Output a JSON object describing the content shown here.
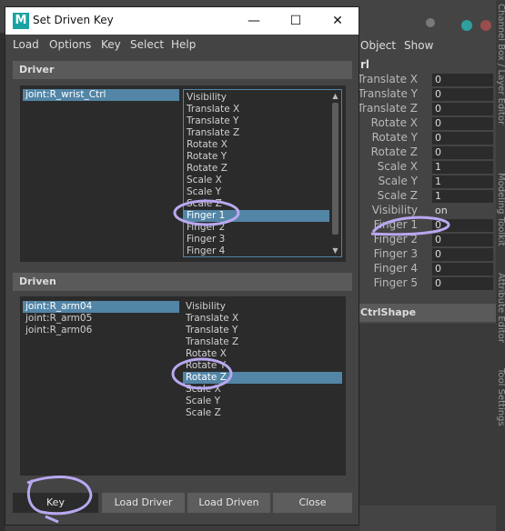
{
  "window": {
    "title": "Set Driven Key",
    "logo": "M",
    "controls": {
      "minimize": "—",
      "maximize": "☐",
      "close": "✕"
    }
  },
  "menu": [
    "Load",
    "Options",
    "Key",
    "Select",
    "Help"
  ],
  "driver": {
    "header": "Driver",
    "objects": [
      {
        "label": "joint:R_wrist_Ctrl",
        "selected": true
      }
    ],
    "attributes": [
      {
        "label": "Visibility"
      },
      {
        "label": "Translate X"
      },
      {
        "label": "Translate Y"
      },
      {
        "label": "Translate Z"
      },
      {
        "label": "Rotate X"
      },
      {
        "label": "Rotate Y"
      },
      {
        "label": "Rotate Z"
      },
      {
        "label": "Scale X"
      },
      {
        "label": "Scale Y"
      },
      {
        "label": "Scale Z"
      },
      {
        "label": "Finger 1",
        "selected": true
      },
      {
        "label": "Finger 2"
      },
      {
        "label": "Finger 3"
      },
      {
        "label": "Finger 4"
      }
    ]
  },
  "driven": {
    "header": "Driven",
    "objects": [
      {
        "label": "joint:R_arm04",
        "selected": true
      },
      {
        "label": "joint:R_arm05"
      },
      {
        "label": "joint:R_arm06"
      }
    ],
    "attributes": [
      {
        "label": "Visibility"
      },
      {
        "label": "Translate X"
      },
      {
        "label": "Translate Y"
      },
      {
        "label": "Translate Z"
      },
      {
        "label": "Rotate X"
      },
      {
        "label": "Rotate Y"
      },
      {
        "label": "Rotate Z",
        "selected": true
      },
      {
        "label": "Scale X"
      },
      {
        "label": "Scale Y"
      },
      {
        "label": "Scale Z"
      }
    ]
  },
  "buttons": {
    "key": "Key",
    "load_driver": "Load Driver",
    "load_driven": "Load Driven",
    "close": "Close"
  },
  "channel_box": {
    "menu": [
      "Object",
      "Show"
    ],
    "node_suffix": "rl",
    "shape_label": "CtrlShape",
    "channels": [
      {
        "label": "Translate X",
        "value": "0"
      },
      {
        "label": "Translate Y",
        "value": "0"
      },
      {
        "label": "Translate Z",
        "value": "0"
      },
      {
        "label": "Rotate X",
        "value": "0"
      },
      {
        "label": "Rotate Y",
        "value": "0"
      },
      {
        "label": "Rotate Z",
        "value": "0"
      },
      {
        "label": "Scale X",
        "value": "1"
      },
      {
        "label": "Scale Y",
        "value": "1"
      },
      {
        "label": "Scale Z",
        "value": "1"
      },
      {
        "label": "Visibility",
        "value": "on"
      },
      {
        "label": "Finger 1",
        "value": "0"
      },
      {
        "label": "Finger 2",
        "value": "0"
      },
      {
        "label": "Finger 3",
        "value": "0"
      },
      {
        "label": "Finger 4",
        "value": "0"
      },
      {
        "label": "Finger 5",
        "value": "0"
      }
    ],
    "side_tabs": [
      "Channel Box / Layer Editor",
      "Modeling Toolkit",
      "Attribute Editor",
      "Tool Settings"
    ]
  },
  "colors": {
    "selection": "#5285a6",
    "annotation": "#b9a8f0",
    "panel": "#444444",
    "list_bg": "#2b2b2b"
  }
}
